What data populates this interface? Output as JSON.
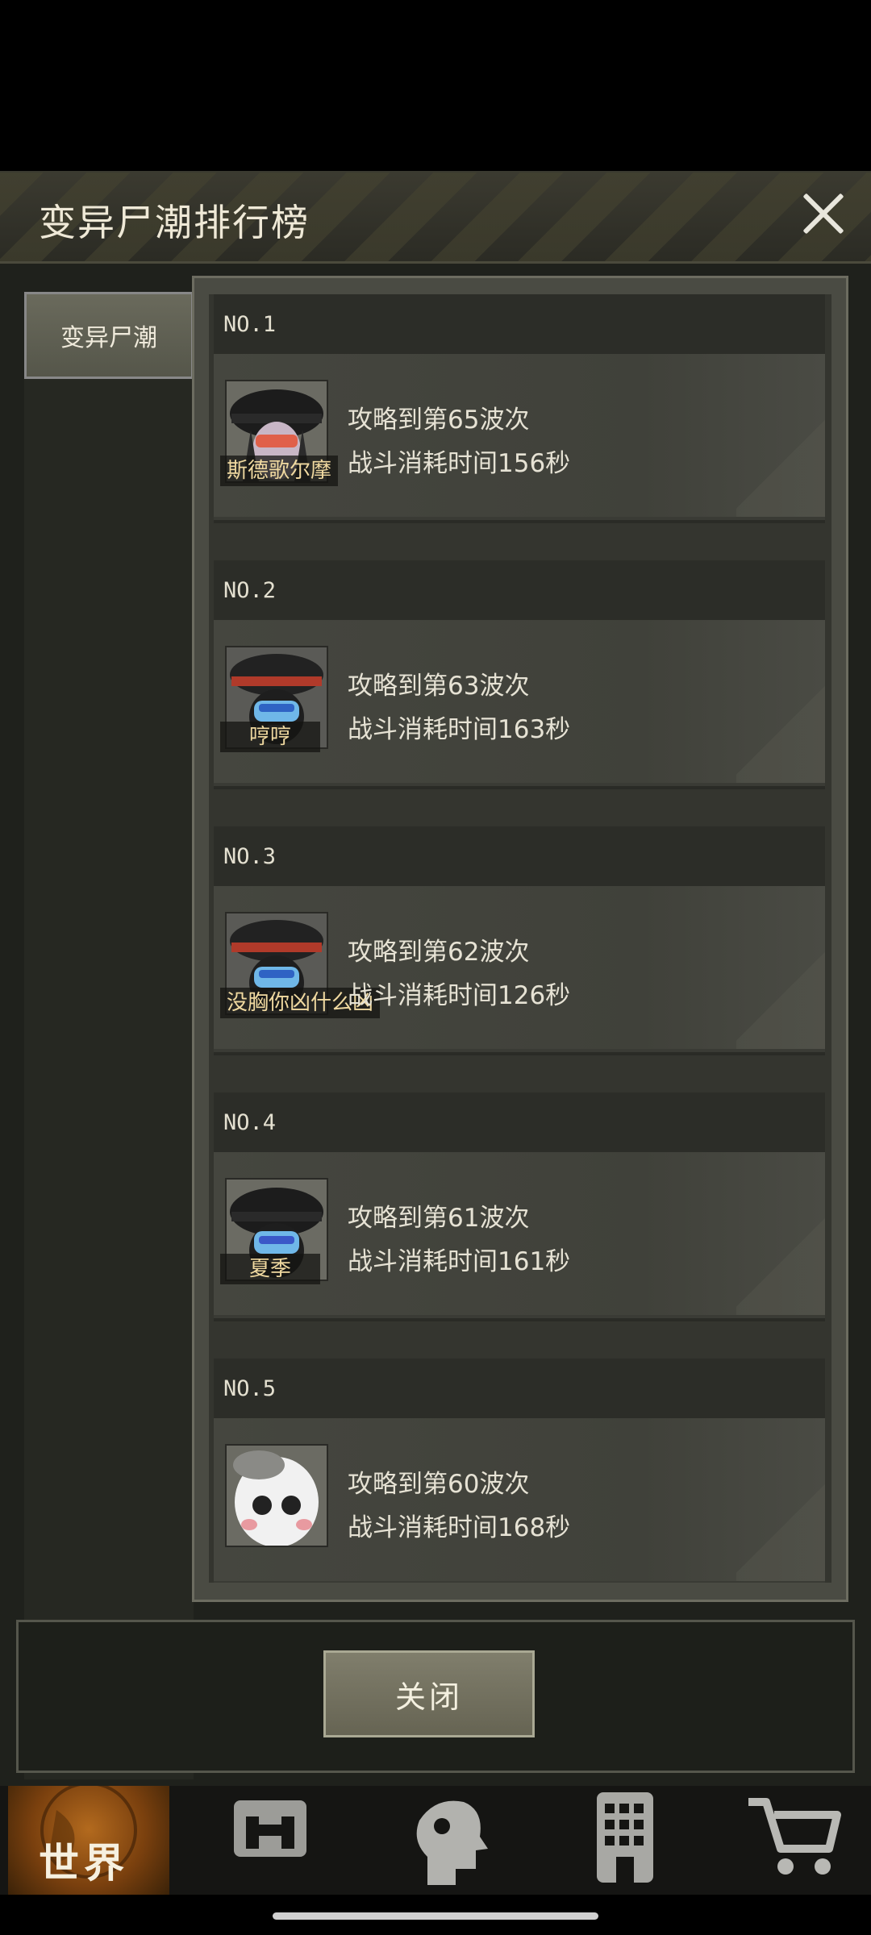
{
  "modal": {
    "title": "变异尸潮排行榜",
    "side_tab_label": "变异尸潮",
    "close_button_label": "关闭"
  },
  "rankings": [
    {
      "rank": "NO.1",
      "player": "斯德歌尔摩",
      "wave": "攻略到第65波次",
      "time": "战斗消耗时间156秒"
    },
    {
      "rank": "NO.2",
      "player": "哼哼",
      "wave": "攻略到第63波次",
      "time": "战斗消耗时间163秒"
    },
    {
      "rank": "NO.3",
      "player": "没胸你凶什么凶",
      "wave": "攻略到第62波次",
      "time": "战斗消耗时间126秒"
    },
    {
      "rank": "NO.4",
      "player": "夏季",
      "wave": "攻略到第61波次",
      "time": "战斗消耗时间161秒"
    },
    {
      "rank": "NO.5",
      "player": "",
      "wave": "攻略到第60波次",
      "time": "战斗消耗时间168秒"
    }
  ],
  "bottom_nav": {
    "world_label": "世界",
    "items": [
      "globe-icon",
      "backpack-icon",
      "head-gear-icon",
      "building-icon",
      "cart-icon"
    ]
  },
  "colors": {
    "accent_orange": "#b36a1e",
    "player_name": "#f0d9a0",
    "panel_bg": "#1f211c"
  }
}
